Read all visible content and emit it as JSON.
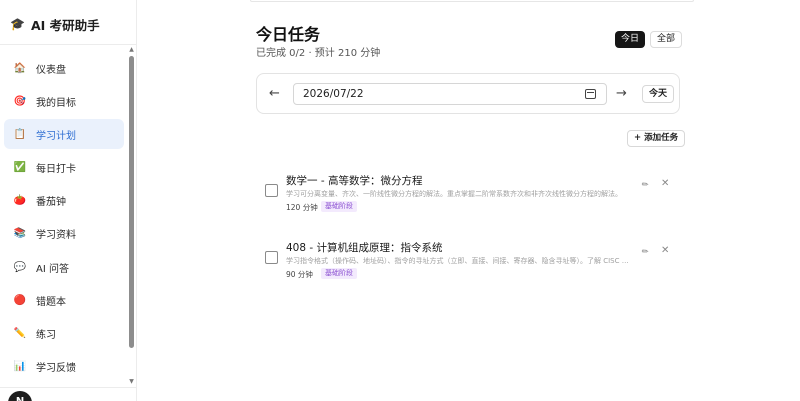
{
  "app": {
    "logo_icon": "graduation-cap-icon",
    "title": "AI 考研助手"
  },
  "sidebar": {
    "items": [
      {
        "icon": "🏠",
        "icon_name": "house-icon",
        "label": "仪表盘"
      },
      {
        "icon": "🎯",
        "icon_name": "target-icon",
        "label": "我的目标"
      },
      {
        "icon": "📋",
        "icon_name": "clipboard-icon",
        "label": "学习计划",
        "active": true
      },
      {
        "icon": "✅",
        "icon_name": "check-icon",
        "label": "每日打卡"
      },
      {
        "icon": "🍅",
        "icon_name": "tomato-icon",
        "label": "番茄钟"
      },
      {
        "icon": "📚",
        "icon_name": "books-icon",
        "label": "学习资料"
      },
      {
        "icon": "💬",
        "icon_name": "speech-bubble-icon",
        "label": "AI 问答"
      },
      {
        "icon": "🔴",
        "icon_name": "red-circle-icon",
        "label": "错题本"
      },
      {
        "icon": "✏️",
        "icon_name": "pencil-icon",
        "label": "练习"
      },
      {
        "icon": "📊",
        "icon_name": "bar-chart-icon",
        "label": "学习反馈"
      }
    ],
    "user_initial": "N"
  },
  "main": {
    "title": "今日任务",
    "subtitle": "已完成 0/2 · 预计 210 分钟",
    "view_today": "今日",
    "view_all": "全部",
    "date_value": "2026/07/22",
    "prev_arrow": "←",
    "next_arrow": "→",
    "today_button": "今天",
    "add_task": "+ 添加任务",
    "tasks": [
      {
        "title": "数学一 - 高等数学：微分方程",
        "desc": "学习可分离变量、齐次、一阶线性微分方程的解法。重点掌握二阶常系数齐次和非齐次线性微分方程的解法。",
        "duration": "120 分钟",
        "stage": "基础阶段"
      },
      {
        "title": "408 - 计算机组成原理：指令系统",
        "desc": "学习指令格式（操作码、地址码）、指令的寻址方式（立即、直接、间接、寄存器、隐含寻址等）。了解 CISC 与 RISC 的区别。",
        "duration": "90 分钟",
        "stage": "基础阶段"
      }
    ]
  },
  "colors": {
    "accent": "#2f6fd2",
    "active_bg": "#eaf1fc",
    "badge_bg": "#f3eafd",
    "badge_text": "#8a4fd1"
  }
}
